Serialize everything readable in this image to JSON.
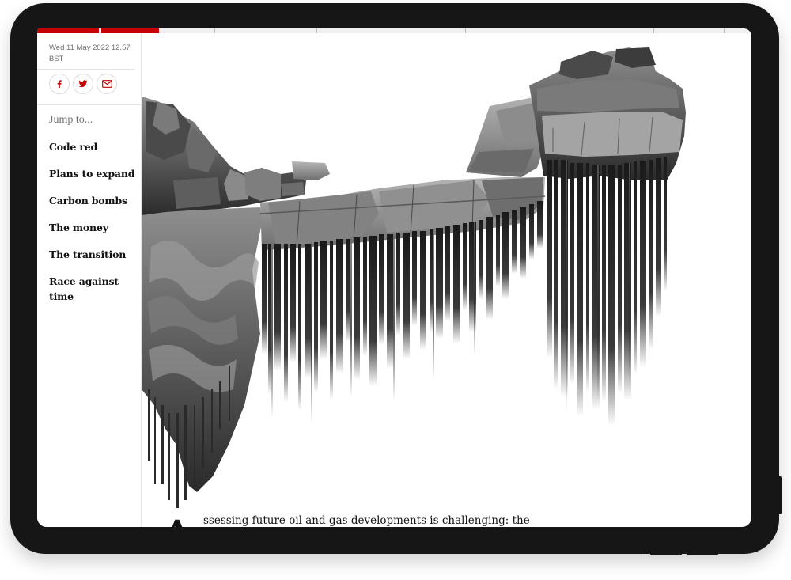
{
  "article": {
    "dateline": "Wed 11 May 2022 12.57 BST",
    "jump_label": "Jump to...",
    "toc": [
      "Code red",
      "Plans to expand",
      "Carbon bombs",
      "The money",
      "The transition",
      "Race against time"
    ],
    "dropcap": "A",
    "first_line": "ssessing future oil and gas developments is challenging: the"
  },
  "share": [
    {
      "name": "facebook-icon",
      "glyph": "f"
    },
    {
      "name": "twitter-icon",
      "glyph": "bird"
    },
    {
      "name": "email-icon",
      "glyph": "envelope"
    }
  ],
  "colors": {
    "accent": "#c70000",
    "device_frame": "#161616",
    "text": "#121212",
    "muted": "#707070",
    "divider": "#e3e3e3",
    "nav_track": "#b8b8b8"
  },
  "hero_image": {
    "subject": "monochrome rocky cliff and rock stacks dissolving into vertical glitch streaks"
  }
}
